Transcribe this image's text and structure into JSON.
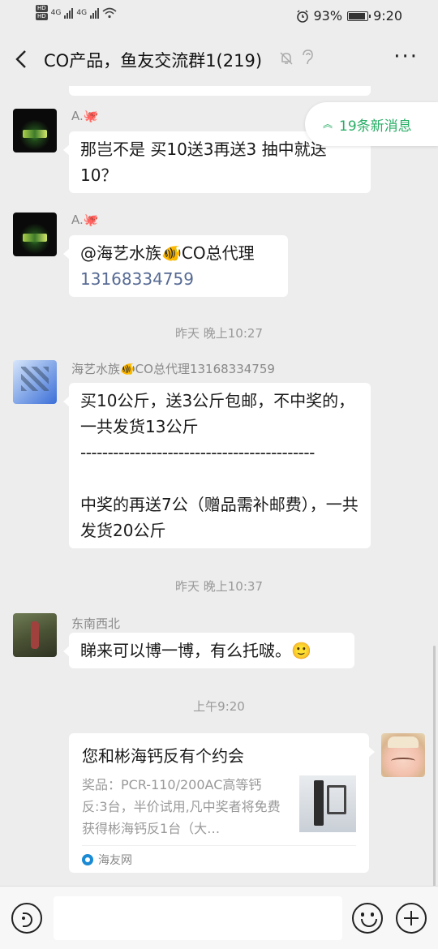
{
  "status_bar": {
    "hd1": "HD",
    "hd2": "HD",
    "net1": "4G",
    "net2": "4G",
    "battery_percent": "93%",
    "battery_level": 0.93,
    "time": "9:20"
  },
  "header": {
    "title": "CO产品，鱼友交流群1(219)",
    "more": "···"
  },
  "new_messages_pill": {
    "label": "19条新消息",
    "chevron": "⌃"
  },
  "messages": [
    {
      "sender": "A.🐙",
      "text": "那岂不是  买10送3再送3  抽中就送10？"
    },
    {
      "sender": "A.🐙",
      "mention": "@海艺水族🐠CO总代理",
      "phone": "13168334759"
    },
    {
      "timestamp": "昨天 晚上10:27"
    },
    {
      "sender": "海艺水族🐠CO总代理13168334759",
      "line1": "买10公斤，送3公斤包邮，不中奖的，一共发货13公斤",
      "divider": "-------------------------------------------",
      "line2": "中奖的再送7公（赠品需补邮费），一共发货20公斤"
    },
    {
      "timestamp": "昨天 晚上10:37"
    },
    {
      "sender": "东南西北",
      "text": "睇来可以博一博，有么托啵。🙂"
    },
    {
      "timestamp": "上午9:20"
    }
  ],
  "card": {
    "title": "您和彬海钙反有个约会",
    "description": "奖品：PCR-110/200AC高等钙反:3台，半价试用,凡中奖者将免费获得彬海钙反1台（大…",
    "source": "海友网"
  },
  "icons": {
    "back": "back-arrow-icon",
    "mute": "mute-bell-icon",
    "ear": "earpiece-icon",
    "voice": "voice-icon",
    "emoji": "emoji-icon",
    "plus": "plus-icon"
  },
  "colors": {
    "background": "#ededed",
    "bubble": "#ffffff",
    "new_msg_green": "#2aae67",
    "link_blue": "#576b95"
  }
}
